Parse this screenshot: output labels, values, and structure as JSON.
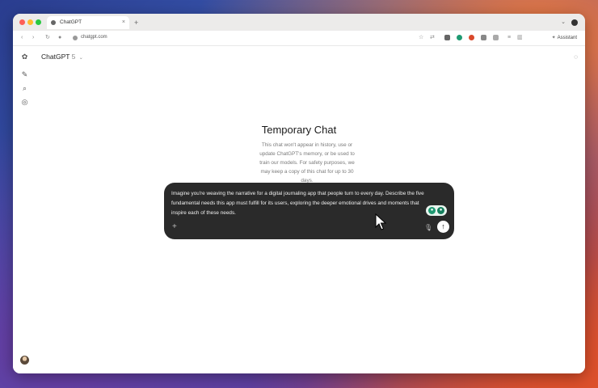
{
  "browser": {
    "tab_title": "ChatGPT",
    "new_tab": "+",
    "tab_close": "×",
    "url": "chatgpt.com",
    "assistant_label": "Assistant"
  },
  "app": {
    "model_name": "ChatGPT",
    "model_version": "5",
    "title": "Temporary Chat",
    "description": "This chat won't appear in history, use or update ChatGPT's memory, or be used to train our models. For safety purposes, we may keep a copy of this chat for up to 30 days.",
    "prompt_text": "Imagine you're weaving the narrative for a digital journaling app that people turn to every day. Describe the five fundamental needs this app must fulfill for its users, exploring the deeper emotional drives and moments that inspire each of these needs."
  },
  "colors": {
    "composer_bg": "#2a2a2a",
    "send_button": "#ffffff",
    "grammar_badge": "#1f9a72"
  },
  "icons": [
    "openai-logo-icon",
    "new-chat-icon",
    "search-icon",
    "library-icon",
    "ghost-icon",
    "plus-icon",
    "mic-icon",
    "send-arrow-icon"
  ]
}
